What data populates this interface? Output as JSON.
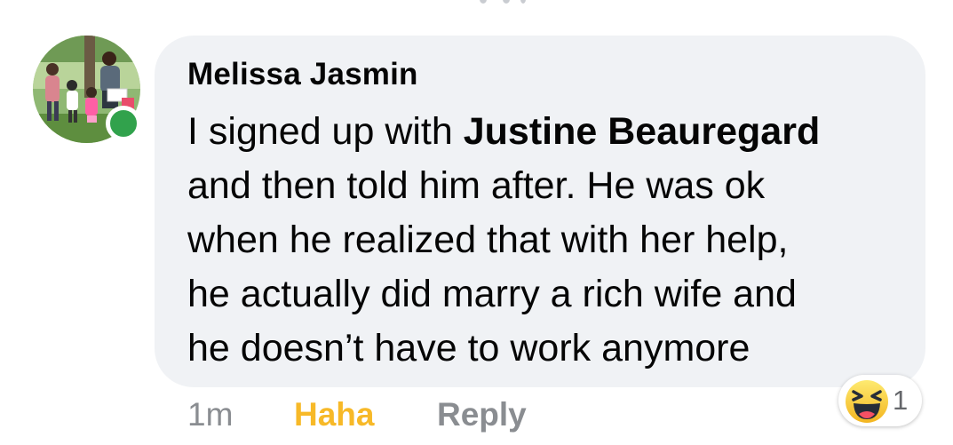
{
  "comment": {
    "author": "Melissa Jasmin",
    "lines": [
      {
        "before": "I signed up with ",
        "mention": "Justine Beauregard",
        "after": ""
      },
      {
        "text": "and then told him after. He was ok"
      },
      {
        "text": "when he realized that with her help,"
      },
      {
        "text": "he actually did marry a rich wife and"
      },
      {
        "text": "he doesn’t have to work anymore"
      }
    ],
    "online": true
  },
  "actions": {
    "time": "1m",
    "reaction_label": "Haha",
    "reply_label": "Reply"
  },
  "reactions": {
    "icon": "haha-emoji-icon",
    "count": "1"
  },
  "colors": {
    "bubble_bg": "#f0f2f5",
    "online": "#31a24c",
    "haha": "#f7b928",
    "muted": "#8a8d91",
    "text": "#050505"
  }
}
